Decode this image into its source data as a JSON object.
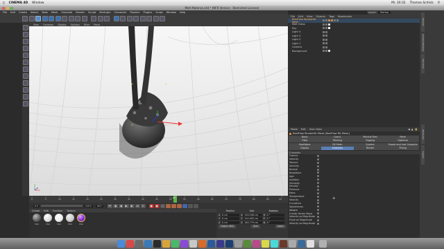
{
  "menubar": {
    "items": [
      "CINEMA 4D",
      "Window"
    ],
    "right": [
      "Mi. 20:32",
      "Thomas Schlick"
    ]
  },
  "window": {
    "title": "Melt Material.c4d * (NFR Version - Restricted License)"
  },
  "c4d_menu": [
    "File",
    "Edit",
    "Create",
    "Select",
    "Tools",
    "Mesh",
    "Simulate",
    "Render",
    "Sculpt",
    "MoGraph",
    "Character",
    "Pipeline",
    "Plugins",
    "Script",
    "Window",
    "Help"
  ],
  "viewport": {
    "menu": [
      "View",
      "Cameras",
      "Display",
      "Options",
      "Filter",
      "Panel"
    ],
    "label": "Perspective"
  },
  "timeline": {
    "ticks": [
      "0",
      "5",
      "10",
      "15",
      "20",
      "25",
      "30",
      "35",
      "40",
      "45",
      "50",
      "55",
      "60",
      "65",
      "70",
      "75",
      "80",
      "85",
      "90"
    ],
    "current_frame": "67",
    "frame_start": "0 F",
    "frame_end": "120 F",
    "frame_field": "90 F"
  },
  "material_manager": {
    "menu": [
      "Create",
      "Edit",
      "Function",
      "Texture"
    ],
    "materials": [
      {
        "name": "Mat",
        "color": "#5d5d5d"
      },
      {
        "name": "Mat",
        "color": "#d8d8d8"
      },
      {
        "name": "Mat",
        "color": "#ececec"
      },
      {
        "name": "Mat",
        "color": "#c9c9c9"
      },
      {
        "name": "Mat",
        "color": "#8b2fd0"
      }
    ]
  },
  "coordinates": {
    "headers": [
      "Position",
      "Size",
      "Rotation"
    ],
    "rows": [
      {
        "axis": "X",
        "pos": "0 cm",
        "size": "150.298 cm",
        "rlabel": "H",
        "rot": "0 °"
      },
      {
        "axis": "Y",
        "pos": "0 cm",
        "size": "124.483 cm",
        "rlabel": "P",
        "rot": "0 °"
      },
      {
        "axis": "Z",
        "pos": "0 cm",
        "size": "180.779 cm",
        "rlabel": "B",
        "rot": "0 °"
      }
    ],
    "mode": "Object (Rel)",
    "size_mode": "Size",
    "apply": "Apply"
  },
  "object_manager": {
    "menu": [
      "File",
      "Edit",
      "View",
      "Objects",
      "Tags",
      "Bookmarks"
    ],
    "search": "Layout:",
    "layout_value": "Startup",
    "objects": [
      {
        "name": "RealFlow RenderKit Mesh",
        "selected": true
      },
      {
        "name": "Melt Glass",
        "selected": false
      },
      {
        "name": "Sky",
        "selected": false
      },
      {
        "name": "Light 4",
        "selected": false
      },
      {
        "name": "Light 3",
        "selected": false
      },
      {
        "name": "Light 2",
        "selected": false
      },
      {
        "name": "Light 1",
        "selected": false
      },
      {
        "name": "Camera",
        "selected": false
      },
      {
        "name": "Background",
        "selected": false
      }
    ]
  },
  "attributes": {
    "menu": [
      "Mode",
      "Edit",
      "User Data"
    ],
    "title": "RealFlow RenderKit Mesh [RealFlow RK Mesh]",
    "tabs": [
      "Basic",
      "Coord.",
      "Particle Files",
      "Mesh",
      "Filter",
      "Filtering",
      "Clipping",
      "Optimize",
      "RealWave",
      "RK Mesh",
      "System",
      "Export and Lost Compute",
      "Display",
      "Channels",
      "Render",
      "Phong"
    ],
    "active_tab": "Channels",
    "section": "Channels",
    "channels": [
      "Frames",
      "Velocity",
      "Texture",
      "Vorticity",
      "Normal",
      "Neighbors",
      "Age",
      "Isolation",
      "Viscosity",
      "Density",
      "Pressure",
      "Mass",
      "Temperature",
      "Velocity",
      "Curvature",
      "Splashiness",
      "Weight",
      "Create Vertex Maps",
      "Velocity as Magnitude",
      "Pulse as Magnitude",
      "Velocity as Magnitude"
    ]
  },
  "right_strip": [
    "Objects",
    "Content Browser",
    "Structure",
    "Attributes",
    "Layers"
  ]
}
